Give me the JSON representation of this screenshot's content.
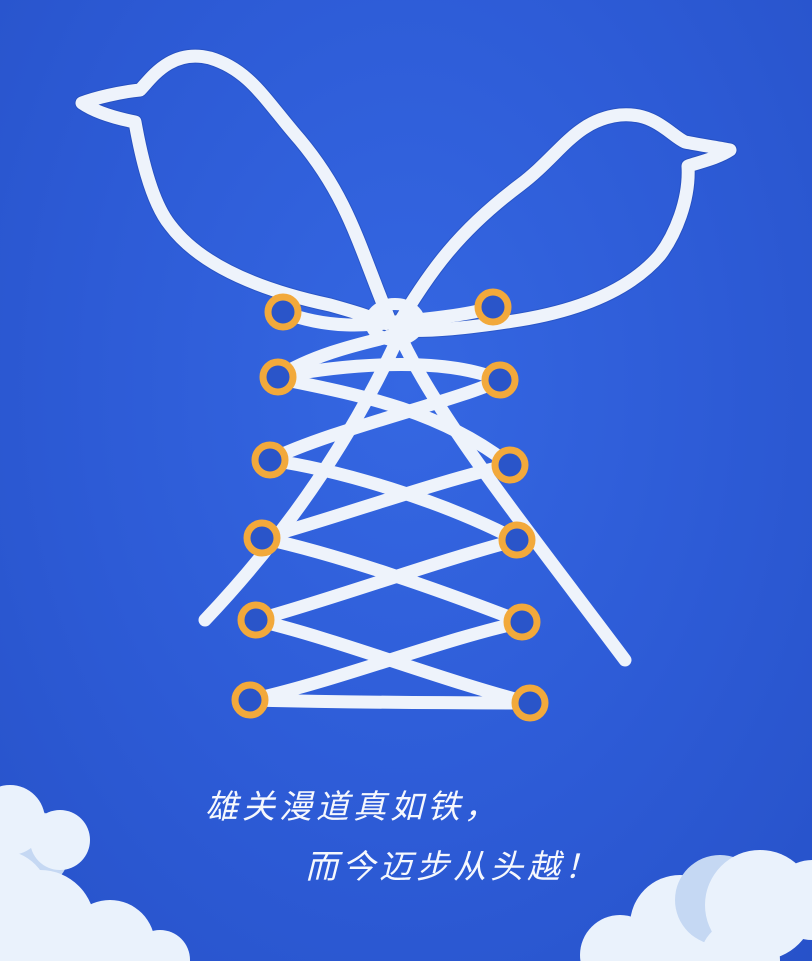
{
  "poster": {
    "poem": {
      "line1": "雄关漫道真如铁，",
      "line2": "而今迈步从头越！"
    }
  },
  "colors": {
    "background": "#2f5fd8",
    "lace": "#eef3fb",
    "eyelet": "#f2a93b",
    "cloud": "#eaf2fc"
  },
  "illustration": {
    "subject": "shoelace",
    "eyelet_rows": 6
  }
}
